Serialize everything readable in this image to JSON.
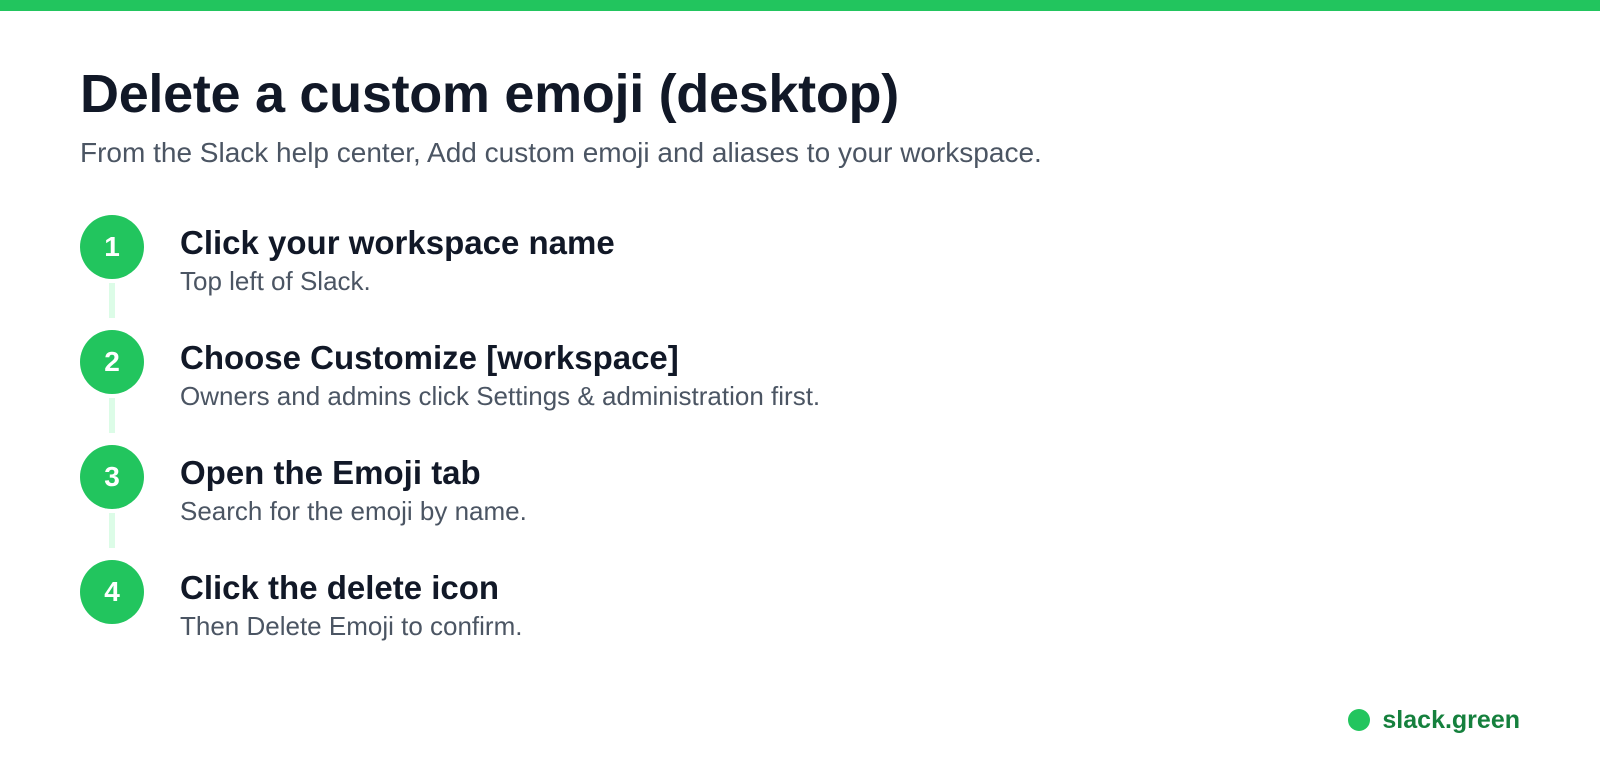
{
  "title": "Delete a custom emoji (desktop)",
  "subtitle": "From the Slack help center, Add custom emoji and aliases to your workspace.",
  "steps": [
    {
      "number": "1",
      "title": "Click your workspace name",
      "description": "Top left of Slack."
    },
    {
      "number": "2",
      "title": "Choose Customize [workspace]",
      "description": "Owners and admins click Settings & administration first."
    },
    {
      "number": "3",
      "title": "Open the Emoji tab",
      "description": "Search for the emoji by name."
    },
    {
      "number": "4",
      "title": "Click the delete icon",
      "description": "Then Delete Emoji to confirm."
    }
  ],
  "brand": {
    "label": "slack.green"
  },
  "colors": {
    "accent": "#22c55e",
    "connector": "#dcfce7",
    "heading": "#111827",
    "body_text": "#4b5563",
    "brand_text": "#15803d"
  }
}
